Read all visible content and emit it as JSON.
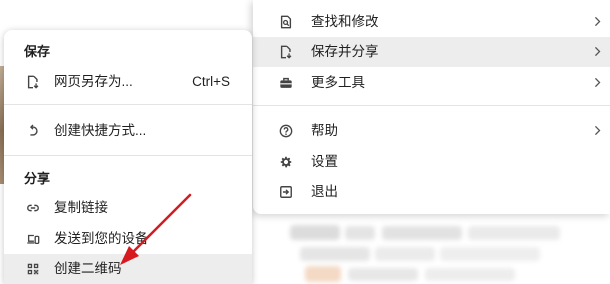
{
  "colors": {
    "menu_background": "#ffffff",
    "hover_background": "#ededed",
    "text": "#1f1f1f",
    "divider": "#e3e3e3",
    "annotation_arrow": "#d61a1f"
  },
  "main_menu": {
    "items": [
      {
        "label": "查找和修改",
        "icon": "find-edit-icon",
        "has_submenu": true
      },
      {
        "label": "保存并分享",
        "icon": "save-share-icon",
        "has_submenu": true,
        "highlighted": true
      },
      {
        "label": "更多工具",
        "icon": "toolbox-icon",
        "has_submenu": true
      },
      {
        "label": "帮助",
        "icon": "help-icon",
        "has_submenu": true
      },
      {
        "label": "设置",
        "icon": "gear-icon",
        "has_submenu": false
      },
      {
        "label": "退出",
        "icon": "exit-icon",
        "has_submenu": false
      }
    ]
  },
  "save_share_submenu": {
    "sections": [
      {
        "heading": "保存",
        "items": [
          {
            "label": "网页另存为...",
            "icon": "save-page-icon",
            "shortcut": "Ctrl+S"
          },
          {
            "label": "创建快捷方式...",
            "icon": "shortcut-icon"
          }
        ]
      },
      {
        "heading": "分享",
        "items": [
          {
            "label": "复制链接",
            "icon": "link-icon"
          },
          {
            "label": "发送到您的设备",
            "icon": "devices-icon"
          },
          {
            "label": "创建二维码",
            "icon": "qr-code-icon",
            "highlighted": true
          }
        ]
      }
    ]
  }
}
